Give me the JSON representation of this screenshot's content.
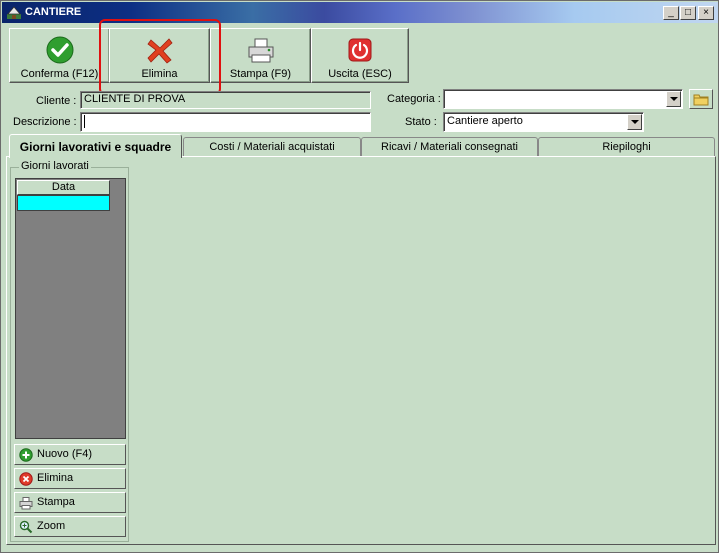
{
  "window": {
    "title": "CANTIERE",
    "controls": [
      "_",
      "□",
      "×"
    ]
  },
  "toolbar": {
    "confirm_label": "Conferma (F12)",
    "delete_label": "Elimina",
    "print_label": "Stampa (F9)",
    "exit_label": "Uscita (ESC)"
  },
  "form": {
    "client_label": "Cliente :",
    "client_value": "CLIENTE DI PROVA",
    "description_label": "Descrizione :",
    "description_value": "",
    "category_label": "Categoria :",
    "category_value": "",
    "state_label": "Stato :",
    "state_value": "Cantiere aperto"
  },
  "tabs": [
    {
      "label": "Giorni lavorativi e squadre"
    },
    {
      "label": "Costi / Materiali acquistati"
    },
    {
      "label": "Ricavi / Materiali consegnati"
    },
    {
      "label": "Riepiloghi"
    }
  ],
  "workdays": {
    "group_title": "Giorni lavorati",
    "column_header": "Data",
    "buttons": {
      "new_label": "Nuovo (F4)",
      "delete_label": "Elimina",
      "print_label": "Stampa",
      "zoom_label": "Zoom"
    }
  },
  "colors": {
    "background": "#c7ddc7",
    "selected_row": "#00ffff",
    "highlight": "#e01010"
  }
}
